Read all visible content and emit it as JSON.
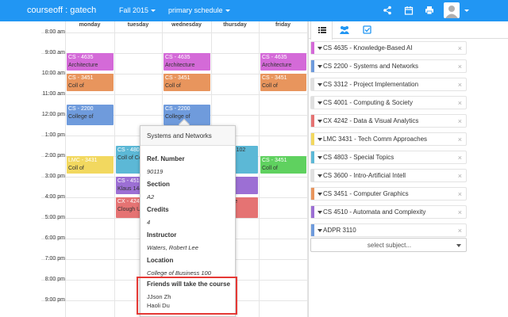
{
  "topbar": {
    "brand": "courseoff : gatech",
    "term": "Fall 2015",
    "schedule": "primary schedule",
    "icons": [
      "share-icon",
      "calendar-icon",
      "print-icon",
      "user-icon"
    ]
  },
  "calendar": {
    "days": [
      "monday",
      "tuesday",
      "wednesday",
      "thursday",
      "friday"
    ],
    "times": [
      "8:00 am",
      "9:00 am",
      "10:00 am",
      "11:00 am",
      "12:00 pm",
      "1:00 pm",
      "2:00 pm",
      "3:00 pm",
      "4:00 pm",
      "5:00 pm",
      "6:00 pm",
      "7:00 pm",
      "8:00 pm",
      "9:00 pm"
    ],
    "events": [
      {
        "day": 0,
        "start": 9.0,
        "end": 9.83,
        "code": "CS - 4635",
        "loc": "Architecture",
        "color": "#d46ad8"
      },
      {
        "day": 2,
        "start": 9.0,
        "end": 9.83,
        "code": "CS - 4635",
        "loc": "Architecture",
        "color": "#d46ad8"
      },
      {
        "day": 4,
        "start": 9.0,
        "end": 9.83,
        "code": "CS - 4635",
        "loc": "Architecture",
        "color": "#d46ad8"
      },
      {
        "day": 0,
        "start": 10.0,
        "end": 10.83,
        "code": "CS - 3451",
        "loc": "Coll of",
        "color": "#e8955d"
      },
      {
        "day": 2,
        "start": 10.0,
        "end": 10.83,
        "code": "CS - 3451",
        "loc": "Coll of",
        "color": "#e8955d"
      },
      {
        "day": 4,
        "start": 10.0,
        "end": 10.83,
        "code": "CS - 3451",
        "loc": "Coll of",
        "color": "#e8955d"
      },
      {
        "day": 0,
        "start": 11.5,
        "end": 12.5,
        "code": "CS - 2200",
        "loc": "College of",
        "color": "#6f9bdc"
      },
      {
        "day": 2,
        "start": 11.5,
        "end": 12.5,
        "code": "CS - 2200",
        "loc": "College of",
        "color": "#6f9bdc"
      },
      {
        "day": 0,
        "start": 14.0,
        "end": 14.83,
        "code": "LMC - 3431",
        "loc": "Coll of",
        "color": "#f2d85f"
      },
      {
        "day": 4,
        "start": 14.0,
        "end": 14.83,
        "code": "CS - 3451",
        "loc": "Coll of",
        "color": "#5fd15f"
      },
      {
        "day": 1,
        "start": 13.5,
        "end": 14.83,
        "code": "CS - 4803",
        "loc": "Coll of Computing",
        "color": "#5cb8d6"
      },
      {
        "day": 3,
        "start": 13.5,
        "end": 14.83,
        "code": "",
        "loc": "Housing 102",
        "color": "#5cb8d6"
      },
      {
        "day": 1,
        "start": 15.0,
        "end": 15.83,
        "code": "CS - 4510",
        "loc": "Klaus 1443",
        "color": "#9c6fd4"
      },
      {
        "day": 3,
        "start": 15.0,
        "end": 15.83,
        "code": "",
        "loc": "",
        "color": "#9c6fd4"
      },
      {
        "day": 1,
        "start": 16.0,
        "end": 17.0,
        "code": "CX - 4242",
        "loc": "Clough Undergrad",
        "color": "#e57373"
      },
      {
        "day": 3,
        "start": 16.0,
        "end": 17.0,
        "code": "",
        "loc": "Graduate",
        "color": "#e57373"
      }
    ]
  },
  "popover": {
    "title": "Systems and Networks",
    "ref_label": "Ref. Number",
    "ref_value": "90119",
    "section_label": "Section",
    "section_value": "A2",
    "credits_label": "Credits",
    "credits_value": "4",
    "instructor_label": "Instructor",
    "instructor_value": "Waters, Robert Lee",
    "location_label": "Location",
    "location_value": "College of Business 100",
    "friends_label": "Friends will take the course",
    "friends": [
      "JJson Zh",
      "Haoli Du"
    ]
  },
  "panel": {
    "tabs": [
      "list-icon",
      "group-icon",
      "checkbox-icon"
    ],
    "courses": [
      {
        "name": "CS 4635 - Knowledge-Based AI",
        "color": "#d46ad8"
      },
      {
        "name": "CS 2200 - Systems and Networks",
        "color": "#6f9bdc"
      },
      {
        "name": "CS 3312 - Project Implementation",
        "color": "#e0e0e0"
      },
      {
        "name": "CS 4001 - Computing & Society",
        "color": "#e0e0e0"
      },
      {
        "name": "CX 4242 - Data & Visual Analytics",
        "color": "#e57373"
      },
      {
        "name": "LMC 3431 - Tech Comm Approaches",
        "color": "#f2d85f"
      },
      {
        "name": "CS 4803 - Special Topics",
        "color": "#5cb8d6"
      },
      {
        "name": "CS 3600 - Intro-Artificial Intell",
        "color": "#e0e0e0"
      },
      {
        "name": "CS 3451 - Computer Graphics",
        "color": "#e8955d"
      },
      {
        "name": "CS 4510 - Automata and Complexity",
        "color": "#9c6fd4"
      },
      {
        "name": "ADPR 3110",
        "color": "#6f9bdc"
      }
    ],
    "remove_glyph": "×",
    "select_placeholder": "select subject..."
  }
}
